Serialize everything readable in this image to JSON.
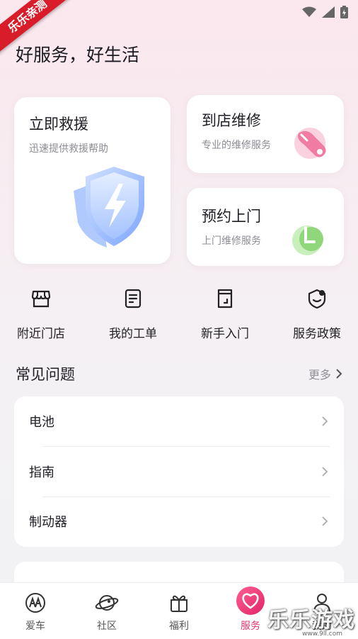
{
  "status_bar": {
    "icons": [
      "wifi-icon",
      "signal-icon",
      "battery-icon"
    ]
  },
  "ribbon": {
    "text": "乐乐亲测"
  },
  "header": {
    "title": "好服务，好生活"
  },
  "cards": {
    "rescue": {
      "title": "立即救援",
      "subtitle": "迅速提供救援帮助"
    },
    "shop": {
      "title": "到店维修",
      "subtitle": "专业的维修服务"
    },
    "visit": {
      "title": "预约上门",
      "subtitle": "上门维修服务"
    }
  },
  "quick_actions": [
    {
      "label": "附近门店",
      "icon": "store-icon"
    },
    {
      "label": "我的工单",
      "icon": "work-order-icon"
    },
    {
      "label": "新手入门",
      "icon": "guide-icon"
    },
    {
      "label": "服务政策",
      "icon": "policy-icon"
    }
  ],
  "faq": {
    "title": "常见问题",
    "more": "更多",
    "items": [
      "电池",
      "指南",
      "制动器"
    ]
  },
  "tabbar": {
    "items": [
      {
        "label": "爱车",
        "icon": "car-logo-icon"
      },
      {
        "label": "社区",
        "icon": "planet-icon"
      },
      {
        "label": "福利",
        "icon": "gift-icon"
      },
      {
        "label": "服务",
        "icon": "heart-service-icon",
        "active": true
      },
      {
        "label": "我的",
        "icon": "profile-icon"
      }
    ]
  },
  "watermark": {
    "text": "乐乐游戏",
    "url": "www.9ll.com"
  },
  "colors": {
    "accent": "#e53770",
    "rescue_blue": "#8fb6ff",
    "shop_pink": "#f07ba3",
    "visit_green": "#8fd77a"
  }
}
